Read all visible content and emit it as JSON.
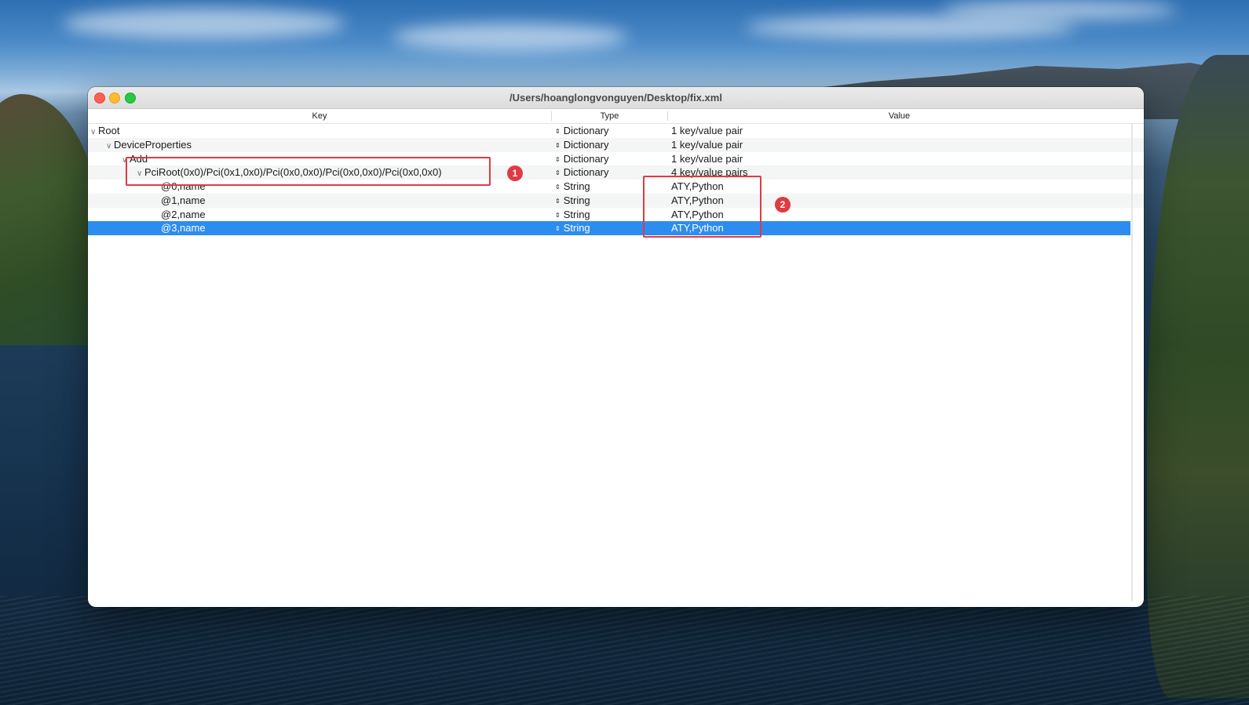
{
  "window": {
    "title": "/Users/hoanglongvonguyen/Desktop/fix.xml"
  },
  "columns": {
    "key": "Key",
    "type": "Type",
    "value": "Value"
  },
  "rows": [
    {
      "key": "Root",
      "type": "Dictionary",
      "value": "1 key/value pair"
    },
    {
      "key": "DeviceProperties",
      "type": "Dictionary",
      "value": "1 key/value pair"
    },
    {
      "key": "Add",
      "type": "Dictionary",
      "value": "1 key/value pair"
    },
    {
      "key": "PciRoot(0x0)/Pci(0x1,0x0)/Pci(0x0,0x0)/Pci(0x0,0x0)/Pci(0x0,0x0)",
      "type": "Dictionary",
      "value": "4 key/value pairs"
    },
    {
      "key": "@0,name",
      "type": "String",
      "value": "ATY,Python"
    },
    {
      "key": "@1,name",
      "type": "String",
      "value": "ATY,Python"
    },
    {
      "key": "@2,name",
      "type": "String",
      "value": "ATY,Python"
    },
    {
      "key": "@3,name",
      "type": "String",
      "value": "ATY,Python"
    }
  ],
  "annotations": {
    "badge1": "1",
    "badge2": "2"
  },
  "colors": {
    "selection": "#2d8cf0",
    "annotation": "#e03a45"
  },
  "icons": {
    "disclosure": "chevron-down-icon",
    "type_stepper": "updown-stepper-icon"
  }
}
